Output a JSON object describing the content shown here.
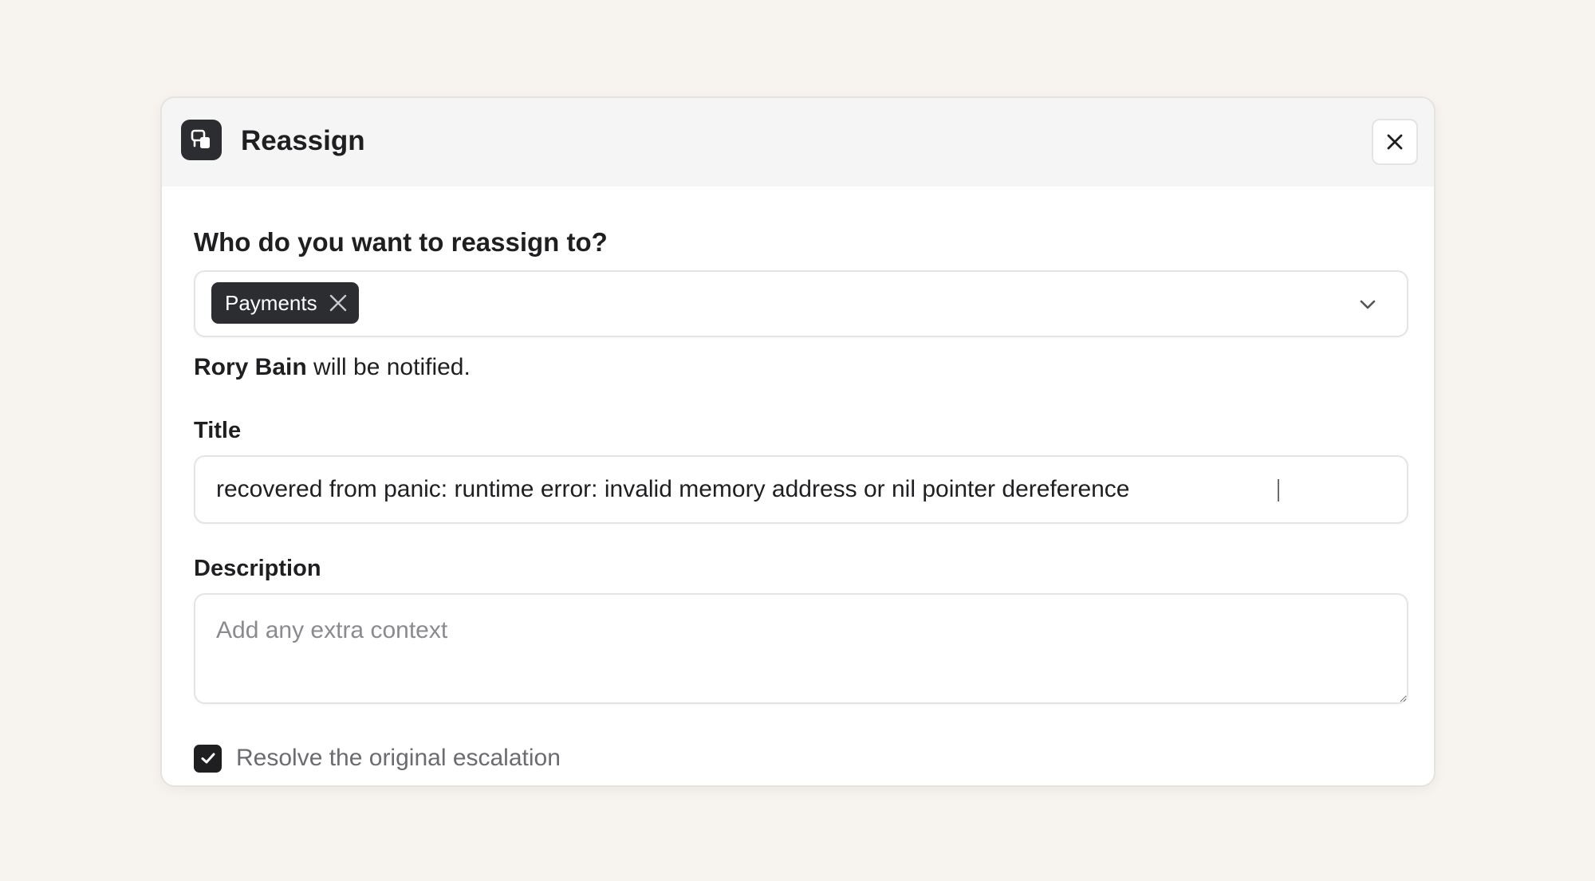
{
  "dialog": {
    "title": "Reassign",
    "header_icon": "reassign-icon",
    "close_icon": "close-icon"
  },
  "assignee": {
    "question": "Who do you want to reassign to?",
    "selected_chip": "Payments",
    "notify_name": "Rory Bain",
    "notify_suffix": " will be notified."
  },
  "title_field": {
    "label": "Title",
    "value": "recovered from panic: runtime error: invalid memory address or nil pointer dereference"
  },
  "description_field": {
    "label": "Description",
    "placeholder": "Add any extra context",
    "value": ""
  },
  "resolve_checkbox": {
    "label": "Resolve the original escalation",
    "checked": true
  },
  "colors": {
    "background": "#f7f4ef",
    "dark": "#2b2d31",
    "border": "#e4e4e7",
    "muted_text": "#6b6b70"
  }
}
